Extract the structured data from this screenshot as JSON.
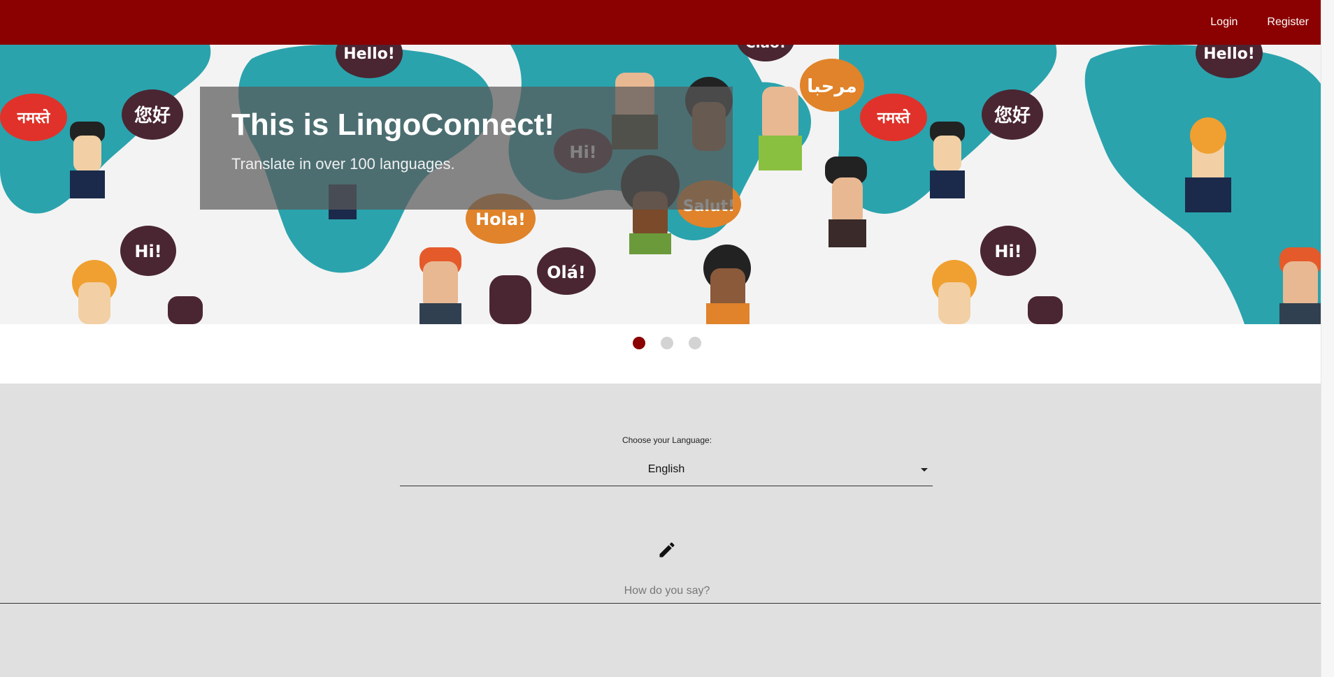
{
  "nav": {
    "login": "Login",
    "register": "Register",
    "brand_color": "#8b0000"
  },
  "hero": {
    "title": "This is LingoConnect!",
    "subtitle": "Translate in over 100 languages.",
    "bubbles": [
      "Hello!",
      "नमस्ते",
      "您好",
      "Hi!",
      "Hola!",
      "Olá!",
      "Salut!",
      "مرحبا",
      "Ciao!",
      "Hello!",
      "नमस्ते",
      "您好",
      "Hi!"
    ],
    "slides": 3,
    "active_slide": 1
  },
  "form": {
    "language_label": "Choose your Language:",
    "selected_language": "English",
    "pencil_icon": "pencil-icon",
    "input_placeholder": "How do you say?"
  }
}
